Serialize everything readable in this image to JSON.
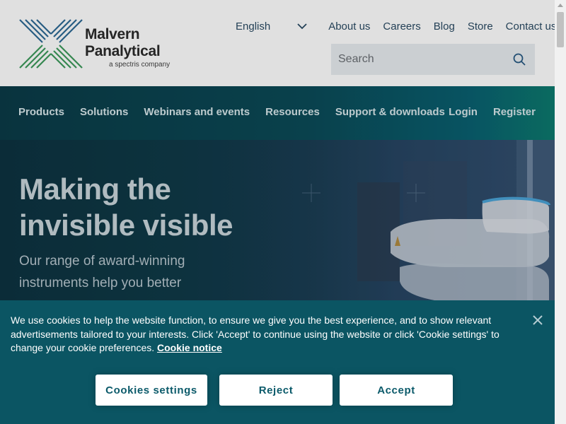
{
  "header": {
    "logo": {
      "name_line1": "Malvern",
      "name_line2": "Panalytical",
      "tagline": "a spectris company"
    },
    "language": "English",
    "top_links": [
      "About us",
      "Careers",
      "Blog",
      "Store",
      "Contact us"
    ],
    "search": {
      "placeholder": "Search",
      "icon": "search-icon"
    }
  },
  "main_nav": {
    "items": [
      "Products",
      "Solutions",
      "Webinars and events",
      "Resources",
      "Support & downloads"
    ],
    "login": "Login",
    "register": "Register"
  },
  "hero": {
    "title_line1": "Making the",
    "title_line2": "invisible visible",
    "subtitle": "Our range of award-winning instruments help you better"
  },
  "cookie_banner": {
    "text": "We use cookies to help the website function, to ensure we give you the best experience, and to show relevant advertisements tailored to your interests. Click 'Accept' to continue using the website or click 'Cookie settings' to change your cookie preferences.",
    "link": "Cookie notice",
    "buttons": {
      "settings": "Cookies settings",
      "reject": "Reject",
      "accept": "Accept"
    },
    "close_icon": "close-icon"
  },
  "colors": {
    "brand_teal": "#0b5563",
    "nav_dark": "#0b3b47",
    "link_blue": "#2a4a63",
    "logo_green": "#3a8c5c",
    "logo_blue": "#2a5c85"
  }
}
